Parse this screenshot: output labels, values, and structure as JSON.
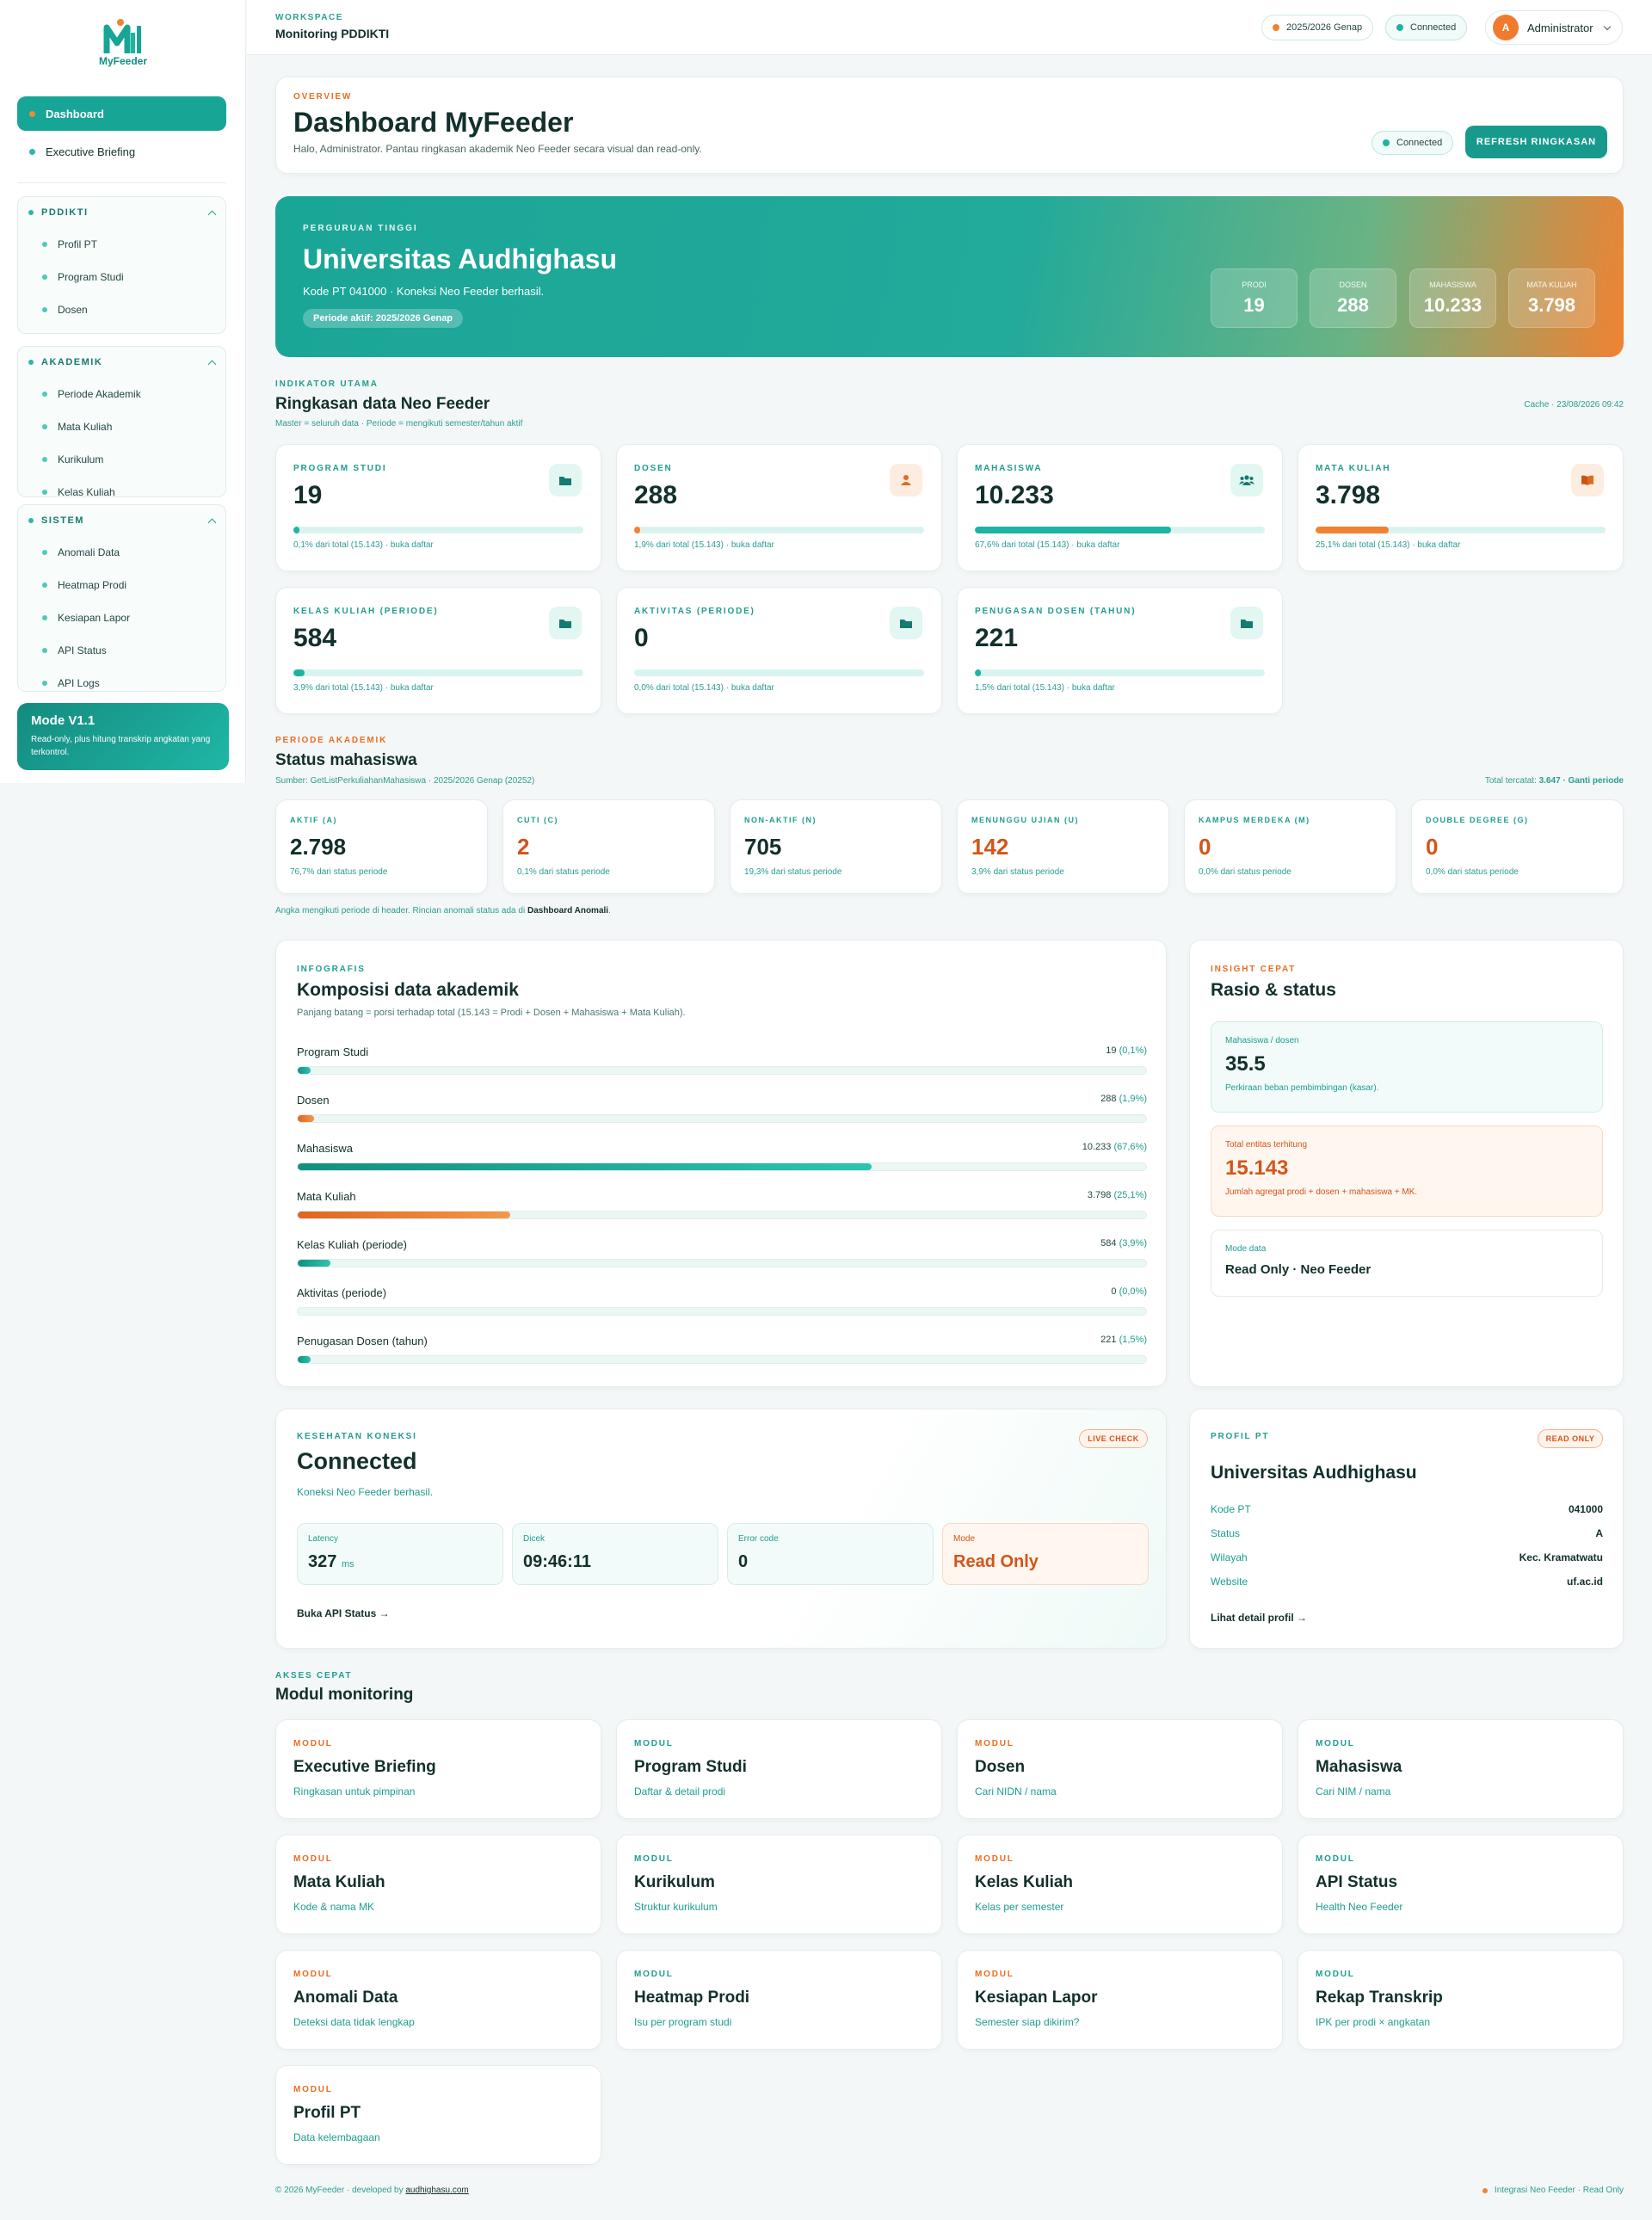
{
  "brand": {
    "name": "MyFeeder"
  },
  "sidebar": {
    "top_items": [
      {
        "label": "Dashboard",
        "active": true
      },
      {
        "label": "Executive Briefing",
        "active": false
      }
    ],
    "groups": [
      {
        "title": "PDDIKTI",
        "items": [
          "Profil PT",
          "Program Studi",
          "Dosen"
        ]
      },
      {
        "title": "AKADEMIK",
        "items": [
          "Periode Akademik",
          "Mata Kuliah",
          "Kurikulum",
          "Kelas Kuliah"
        ]
      },
      {
        "title": "SISTEM",
        "items": [
          "Anomali Data",
          "Heatmap Prodi",
          "Kesiapan Lapor",
          "API Status",
          "API Logs"
        ]
      }
    ],
    "mode_card": {
      "title": "Mode V1.1",
      "desc": "Read-only, plus hitung transkrip angkatan yang terkontrol."
    }
  },
  "topbar": {
    "workspace_label": "WORKSPACE",
    "workspace_name": "Monitoring PDDIKTI",
    "period_pill": "2025/2026 Genap",
    "status_pill": "Connected",
    "user": {
      "initial": "A",
      "name": "Administrator"
    }
  },
  "overview": {
    "label": "OVERVIEW",
    "title": "Dashboard MyFeeder",
    "subtitle": "Halo, Administrator. Pantau ringkasan akademik Neo Feeder secara visual dan read-only.",
    "status": "Connected",
    "refresh_button": "REFRESH RINGKASAN"
  },
  "hero": {
    "label": "PERGURUAN TINGGI",
    "name": "Universitas Audhighasu",
    "sub": "Kode PT 041000 · Koneksi Neo Feeder berhasil.",
    "badge": "Periode aktif: 2025/2026 Genap",
    "stats": [
      {
        "label": "PRODI",
        "value": "19"
      },
      {
        "label": "DOSEN",
        "value": "288"
      },
      {
        "label": "MAHASISWA",
        "value": "10.233"
      },
      {
        "label": "MATA KULIAH",
        "value": "3.798"
      }
    ]
  },
  "indicators": {
    "label": "INDIKATOR UTAMA",
    "title": "Ringkasan data Neo Feeder",
    "subtitle": "Master = seluruh data · Periode = mengikuti semester/tahun aktif",
    "cache": "Cache · 23/08/2026 09:42",
    "cards": [
      {
        "label": "PROGRAM STUDI",
        "value": "19",
        "pct": 0.1,
        "note": "0,1% dari total (15.143) · buka daftar",
        "icon": "folder-icon",
        "accent": "teal"
      },
      {
        "label": "DOSEN",
        "value": "288",
        "pct": 1.9,
        "note": "1,9% dari total (15.143) · buka daftar",
        "icon": "person-icon",
        "accent": "orange"
      },
      {
        "label": "MAHASISWA",
        "value": "10.233",
        "pct": 67.6,
        "note": "67,6% dari total (15.143) · buka daftar",
        "icon": "group-icon",
        "accent": "teal"
      },
      {
        "label": "MATA KULIAH",
        "value": "3.798",
        "pct": 25.1,
        "note": "25,1% dari total (15.143) · buka daftar",
        "icon": "book-icon",
        "accent": "orange"
      },
      {
        "label": "KELAS KULIAH (PERIODE)",
        "value": "584",
        "pct": 3.9,
        "note": "3,9% dari total (15.143) · buka daftar",
        "icon": "folder-icon",
        "accent": "teal"
      },
      {
        "label": "AKTIVITAS (PERIODE)",
        "value": "0",
        "pct": 0.0,
        "note": "0,0% dari total (15.143) · buka daftar",
        "icon": "folder-icon",
        "accent": "teal"
      },
      {
        "label": "PENUGASAN DOSEN (TAHUN)",
        "value": "221",
        "pct": 1.5,
        "note": "1,5% dari total (15.143) · buka daftar",
        "icon": "folder-icon",
        "accent": "teal"
      }
    ]
  },
  "status": {
    "label": "PERIODE AKADEMIK",
    "title": "Status mahasiswa",
    "source": "Sumber: GetListPerkuliahanMahasiswa · 2025/2026 Genap (20252)",
    "total_prefix": "Total tercatat: ",
    "total_value": "3.647",
    "total_suffix": " · Ganti periode",
    "cards": [
      {
        "label": "AKTIF (A)",
        "value": "2.798",
        "note": "76,7% dari status periode",
        "warn": false
      },
      {
        "label": "CUTI (C)",
        "value": "2",
        "note": "0,1% dari status periode",
        "warn": true
      },
      {
        "label": "NON-AKTIF (N)",
        "value": "705",
        "note": "19,3% dari status periode",
        "warn": false
      },
      {
        "label": "MENUNGGU UJIAN (U)",
        "value": "142",
        "note": "3,9% dari status periode",
        "warn": true
      },
      {
        "label": "KAMPUS MERDEKA (M)",
        "value": "0",
        "note": "0,0% dari status periode",
        "warn": true
      },
      {
        "label": "DOUBLE DEGREE (G)",
        "value": "0",
        "note": "0,0% dari status periode",
        "warn": true
      }
    ],
    "footnote_a": "Angka mengikuti periode di header. Rincian anomali status ada di ",
    "footnote_b": "Dashboard Anomali",
    "footnote_c": "."
  },
  "composition": {
    "label": "INFOGRAFIS",
    "title": "Komposisi data akademik",
    "subtitle": "Panjang batang = porsi terhadap total (15.143 = Prodi + Dosen + Mahasiswa + Mata Kuliah).",
    "rows": [
      {
        "name": "Program Studi",
        "value": "19",
        "pct_label": "(0,1%)",
        "pct": 0.1,
        "accent": "teal"
      },
      {
        "name": "Dosen",
        "value": "288",
        "pct_label": "(1,9%)",
        "pct": 1.9,
        "accent": "orange"
      },
      {
        "name": "Mahasiswa",
        "value": "10.233",
        "pct_label": "(67,6%)",
        "pct": 67.6,
        "accent": "teal"
      },
      {
        "name": "Mata Kuliah",
        "value": "3.798",
        "pct_label": "(25,1%)",
        "pct": 25.1,
        "accent": "orange"
      },
      {
        "name": "Kelas Kuliah (periode)",
        "value": "584",
        "pct_label": "(3,9%)",
        "pct": 3.9,
        "accent": "teal"
      },
      {
        "name": "Aktivitas (periode)",
        "value": "0",
        "pct_label": "(0,0%)",
        "pct": 0.0,
        "accent": "teal"
      },
      {
        "name": "Penugasan Dosen (tahun)",
        "value": "221",
        "pct_label": "(1,5%)",
        "pct": 1.5,
        "accent": "teal"
      }
    ]
  },
  "insight": {
    "label": "INSIGHT CEPAT",
    "title": "Rasio & status",
    "items": [
      {
        "label": "Mahasiswa / dosen",
        "value": "35.5",
        "desc": "Perkiraan beban pembimbingan (kasar)."
      },
      {
        "label": "Total entitas terhitung",
        "value": "15.143",
        "desc": "Jumlah agregat prodi + dosen + mahasiswa + MK."
      },
      {
        "label": "Mode data",
        "value": "Read Only · Neo Feeder"
      }
    ]
  },
  "health": {
    "label": "KESEHATAN KONEKSI",
    "badge": "LIVE CHECK",
    "title": "Connected",
    "subtitle": "Koneksi Neo Feeder berhasil.",
    "metrics": [
      {
        "label": "Latency",
        "value": "327",
        "unit": "ms"
      },
      {
        "label": "Dicek",
        "value": "09:46:11"
      },
      {
        "label": "Error code",
        "value": "0"
      },
      {
        "label": "Mode",
        "value": "Read Only"
      }
    ],
    "link": "Buka API Status →"
  },
  "profile": {
    "label": "PROFIL PT",
    "badge": "READ ONLY",
    "title": "Universitas Audhighasu",
    "rows": [
      {
        "key": "Kode PT",
        "value": "041000"
      },
      {
        "key": "Status",
        "value": "A"
      },
      {
        "key": "Wilayah",
        "value": "Kec. Kramatwatu"
      },
      {
        "key": "Website",
        "value": "uf.ac.id"
      }
    ],
    "link": "Lihat detail profil →"
  },
  "modules": {
    "label": "AKSES CEPAT",
    "title": "Modul monitoring",
    "item_label": "MODUL",
    "items": [
      {
        "title": "Executive Briefing",
        "desc": "Ringkasan untuk pimpinan",
        "accent": "orange"
      },
      {
        "title": "Program Studi",
        "desc": "Daftar & detail prodi",
        "accent": "teal"
      },
      {
        "title": "Dosen",
        "desc": "Cari NIDN / nama",
        "accent": "orange"
      },
      {
        "title": "Mahasiswa",
        "desc": "Cari NIM / nama",
        "accent": "teal"
      },
      {
        "title": "Mata Kuliah",
        "desc": "Kode & nama MK",
        "accent": "orange"
      },
      {
        "title": "Kurikulum",
        "desc": "Struktur kurikulum",
        "accent": "teal"
      },
      {
        "title": "Kelas Kuliah",
        "desc": "Kelas per semester",
        "accent": "orange"
      },
      {
        "title": "API Status",
        "desc": "Health Neo Feeder",
        "accent": "teal"
      },
      {
        "title": "Anomali Data",
        "desc": "Deteksi data tidak lengkap",
        "accent": "orange"
      },
      {
        "title": "Heatmap Prodi",
        "desc": "Isu per program studi",
        "accent": "teal"
      },
      {
        "title": "Kesiapan Lapor",
        "desc": "Semester siap dikirim?",
        "accent": "orange"
      },
      {
        "title": "Rekap Transkrip",
        "desc": "IPK per prodi × angkatan",
        "accent": "teal"
      },
      {
        "title": "Profil PT",
        "desc": "Data kelembagaan",
        "accent": "orange"
      }
    ]
  },
  "footer": {
    "left_a": "© 2026 MyFeeder · developed by ",
    "left_b": "audhighasu.com",
    "right": "Integrasi Neo Feeder · Read Only"
  },
  "colors": {
    "teal": "#1fb3a3",
    "orange": "#f08232",
    "teal_dark": "#179a8c"
  }
}
